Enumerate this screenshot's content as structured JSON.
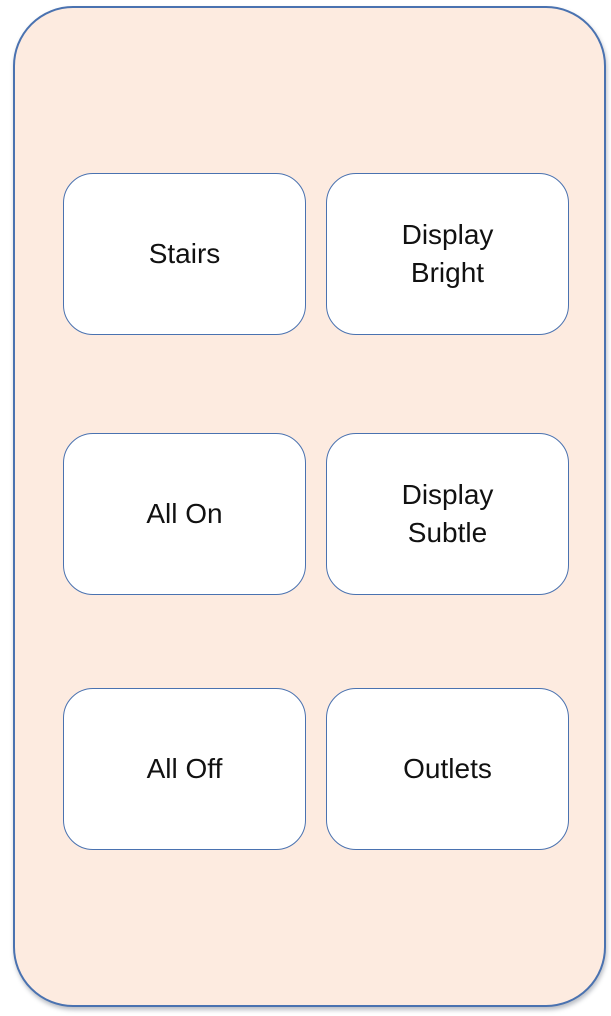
{
  "colors": {
    "panel_bg": "#fdebe0",
    "accent": "#4a72b0",
    "button_bg": "#ffffff",
    "text": "#111111"
  },
  "buttons": [
    {
      "label": "Stairs"
    },
    {
      "label": "Display\nBright"
    },
    {
      "label": "All On"
    },
    {
      "label": "Display\nSubtle"
    },
    {
      "label": "All Off"
    },
    {
      "label": "Outlets"
    }
  ]
}
